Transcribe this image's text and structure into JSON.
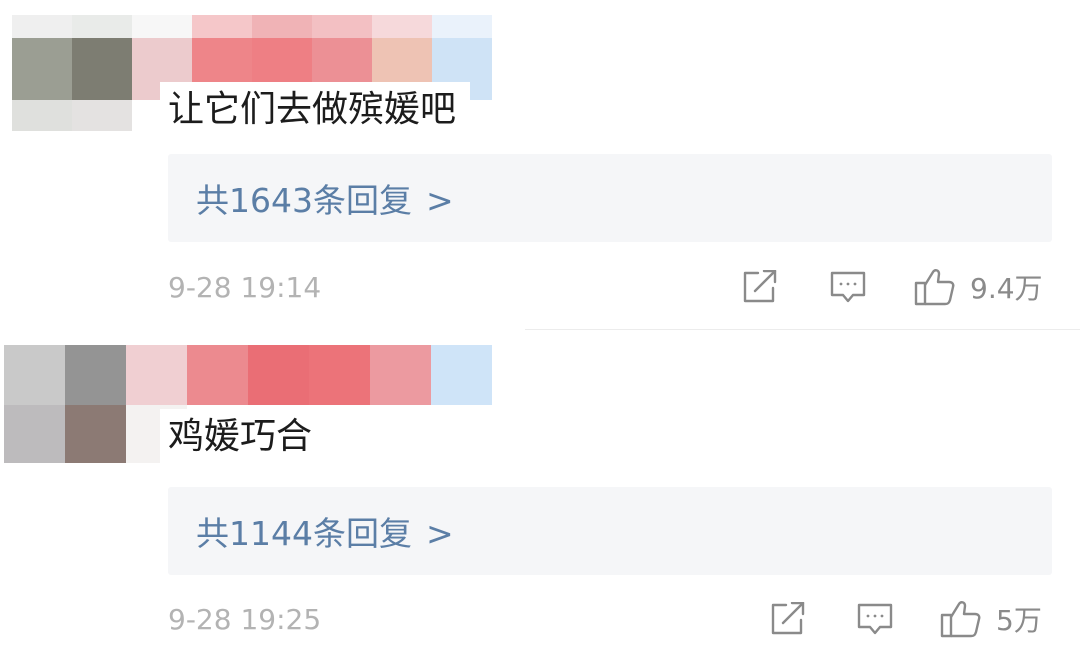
{
  "comments": [
    {
      "avatar_pixels": [
        "#efefef",
        "#e9ebe9",
        "#f7f7f7",
        "#f5c7c9",
        "#f0b3b6",
        "#f3c0c3",
        "#f6d9db",
        "#eaf2fb",
        "#9b9e93",
        "#7d7d72",
        "#eccbcd",
        "#ee8589",
        "#ee7f84",
        "#ec9095",
        "#eec3b4",
        "#cfe3f6",
        "#dfe0dd",
        "#e4e2e1",
        "#ffffff",
        "#ffffff",
        "#ffffff",
        "#ffffff",
        "#ffffff",
        "#ffffff"
      ],
      "text": "让它们去做殡媛吧",
      "reply_link": "共1643条回复",
      "reply_chevron": ">",
      "timestamp": "9-28 19:14",
      "like_count": "9.4万"
    },
    {
      "avatar_pixels": [
        "#c9c9c9",
        "#949494",
        "#f0cfd2",
        "#ec8a8f",
        "#ea6e75",
        "#ec7379",
        "#ec9aa0",
        "#cfe4f8",
        "#bdbbbd",
        "#8c7a74",
        "#f4f2f1",
        "#ffffff",
        "#ffffff",
        "#ffffff",
        "#ffffff",
        "#ffffff"
      ],
      "text": "鸡媛巧合",
      "reply_link": "共1144条回复",
      "reply_chevron": ">",
      "timestamp": "9-28 19:25",
      "like_count": "5万"
    }
  ],
  "icons": {
    "share": "share-icon",
    "comment": "comment-icon",
    "like": "thumbs-up-icon"
  },
  "colors": {
    "reply_link": "#5b7ea6",
    "reply_box_bg": "#f5f6f8",
    "timestamp": "#b3b3b3",
    "icon": "#8a8a8a"
  }
}
